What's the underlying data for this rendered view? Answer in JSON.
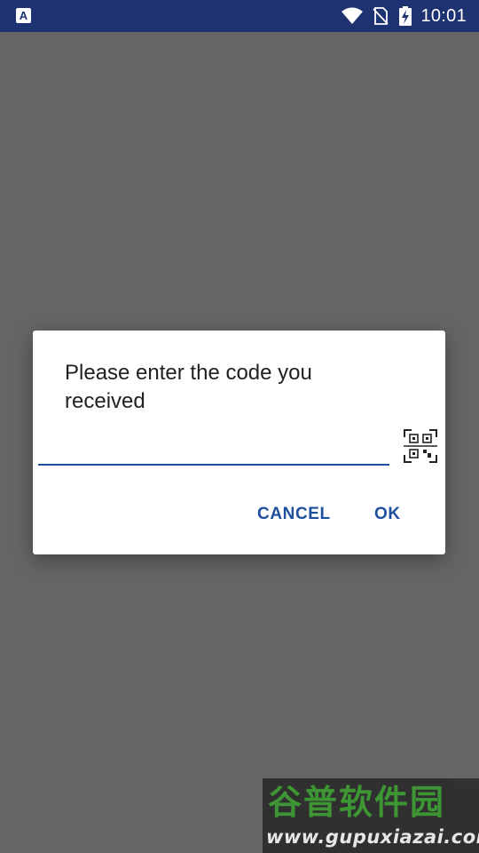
{
  "status_bar": {
    "app_icon_letter": "A",
    "time": "10:01",
    "icons": [
      "text-app-icon",
      "wifi-icon",
      "no-sim-icon",
      "battery-charging-icon"
    ]
  },
  "dialog": {
    "title": "Please enter the code you received",
    "input": {
      "value": "",
      "placeholder": ""
    },
    "scan_icon": "qr-code-scan-icon",
    "buttons": {
      "cancel": "CANCEL",
      "ok": "OK"
    },
    "accent_color": "#1e4f9c"
  },
  "watermark": {
    "logo_text": "谷普软件园",
    "url": "www.gupuxiazai.com"
  },
  "colors": {
    "status_bar": "#1e3170",
    "scrim": "#656565",
    "dialog_bg": "#ffffff"
  }
}
